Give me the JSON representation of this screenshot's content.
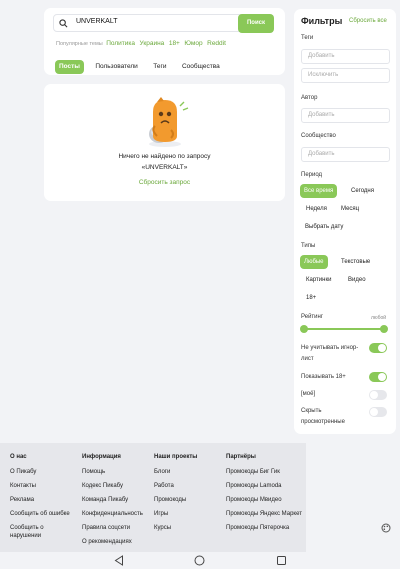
{
  "search": {
    "query": "UNVERKALT",
    "button": "Поиск"
  },
  "popular": {
    "label": "Популярные темы",
    "tags": [
      "Политика",
      "Украина",
      "18+",
      "Юмор",
      "Reddit"
    ]
  },
  "tabs": [
    "Посты",
    "Пользователи",
    "Теги",
    "Сообщества"
  ],
  "result": {
    "line1": "Ничего не найдено по запросу",
    "line2": "«UNVERKALT»",
    "reset": "Сбросить запрос"
  },
  "filters": {
    "title": "Фильтры",
    "reset": "Сбросить все",
    "tags_label": "Теги",
    "tags_add_placeholder": "Добавить",
    "tags_exclude_placeholder": "Исключить",
    "author_label": "Автор",
    "author_placeholder": "Добавить",
    "community_label": "Сообщество",
    "community_placeholder": "Добавить",
    "period_label": "Период",
    "period_options": [
      "Все время",
      "Сегодня",
      "Неделя",
      "Месяц",
      "Выбрать дату"
    ],
    "types_label": "Типы",
    "type_options": [
      "Любые",
      "Текстовые",
      "Картинки",
      "Видео",
      "18+"
    ],
    "rating_label": "Рейтинг",
    "rating_value": "любой",
    "toggles": [
      {
        "label": "Не учитывать игнор-лист",
        "on": true
      },
      {
        "label": "Показывать 18+",
        "on": true
      },
      {
        "label": "[моё]",
        "on": false
      },
      {
        "label": "Скрыть просмотренные",
        "on": false
      }
    ]
  },
  "footer": {
    "about": {
      "title": "О нас",
      "items": [
        "О Пикабу",
        "Контакты",
        "Реклама",
        "Сообщить об ошибке",
        "Сообщить о нарушении"
      ]
    },
    "info": {
      "title": "Информация",
      "items": [
        "Помощь",
        "Кодекс Пикабу",
        "Команда Пикабу",
        "Конфиденциальность",
        "Правила соцсети",
        "О рекомендациях"
      ]
    },
    "projects": {
      "title": "Наши проекты",
      "items": [
        "Блоги",
        "Работа",
        "Промокоды",
        "Игры",
        "Курсы"
      ]
    },
    "partners": {
      "title": "Партнёры",
      "items": [
        "Промокоды Биг Гик",
        "Промокоды Lamoda",
        "Промокоды Мвидео",
        "Промокоды Яндекс Маркет",
        "Промокоды Пятерочка"
      ]
    }
  },
  "colors": {
    "accent": "#8ac858",
    "link": "#6aa83a",
    "background": "#f2f3f6"
  }
}
